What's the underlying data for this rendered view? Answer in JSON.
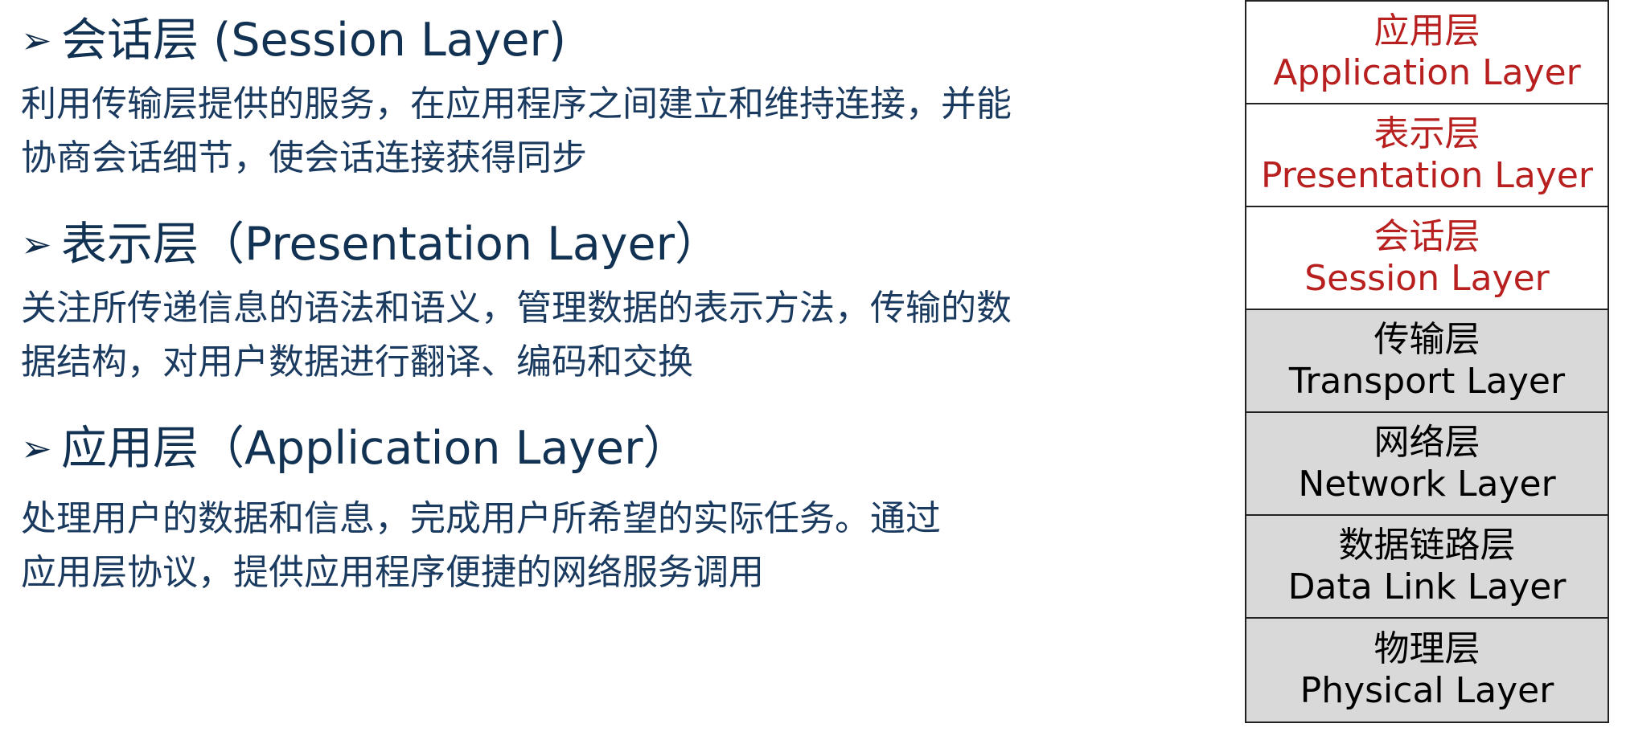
{
  "sections": [
    {
      "heading": "会话层 (Session Layer)",
      "lines": [
        "利用传输层提供的服务，在应用程序之间建立和维持连接，并能",
        "协商会话细节，使会话连接获得同步"
      ]
    },
    {
      "heading": "表示层（Presentation Layer）",
      "lines": [
        "关注所传递信息的语法和语义，管理数据的表示方法，传输的数",
        "据结构，对用户数据进行翻译、编码和交换"
      ]
    },
    {
      "heading": "应用层（Application Layer）",
      "lines": [
        "处理用户的数据和信息，完成用户所希望的实际任务。通过",
        "应用层协议，提供应用程序便捷的网络服务调用"
      ]
    }
  ],
  "bullet_symbol": "➢",
  "osi_layers": [
    {
      "zh": "应用层",
      "en": "Application Layer",
      "highlight": true
    },
    {
      "zh": "表示层",
      "en": "Presentation Layer",
      "highlight": true
    },
    {
      "zh": "会话层",
      "en": "Session Layer",
      "highlight": true
    },
    {
      "zh": "传输层",
      "en": "Transport Layer",
      "highlight": false
    },
    {
      "zh": "网络层",
      "en": "Network Layer",
      "highlight": false
    },
    {
      "zh": "数据链路层",
      "en": "Data Link Layer",
      "highlight": false
    },
    {
      "zh": "物理层",
      "en": "Physical Layer",
      "highlight": false
    }
  ],
  "colors": {
    "heading": "#123253",
    "body_text": "#1a3a5f",
    "highlight_text": "#b81f1f",
    "lower_layer_bg": "#d9d9d9",
    "border": "#222222"
  }
}
